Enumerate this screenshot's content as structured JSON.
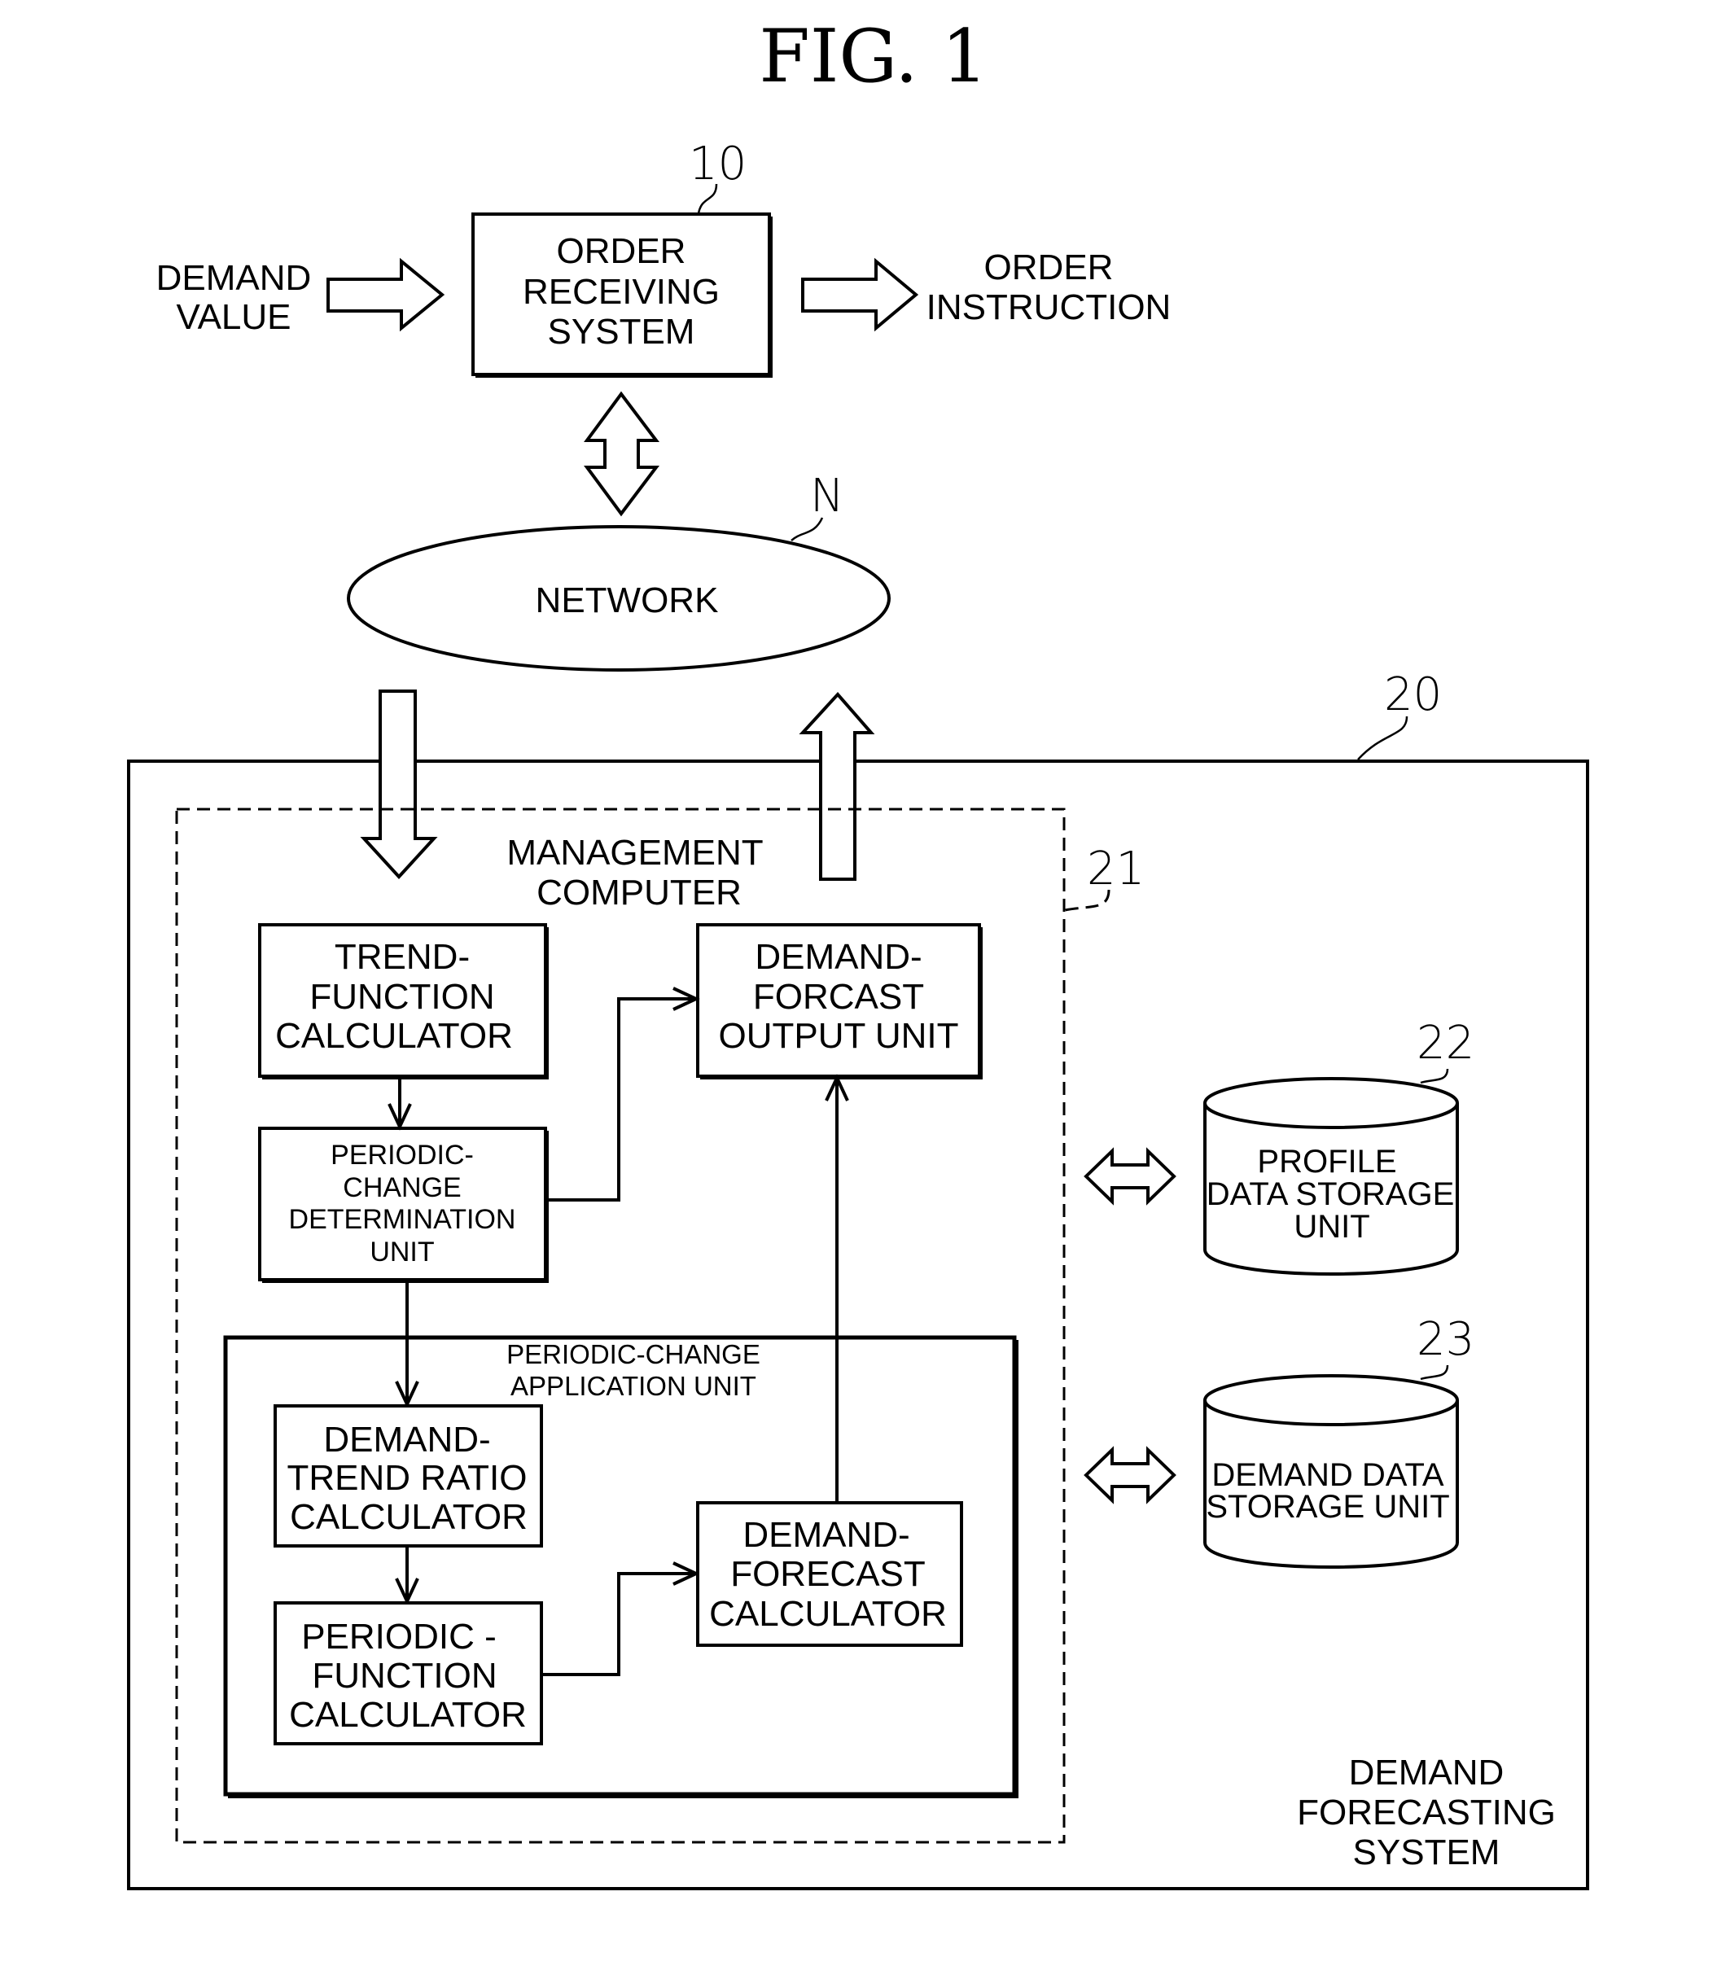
{
  "figure": {
    "title": "FIG. 1",
    "ref_numerals": {
      "order_system": "10",
      "network": "N",
      "forecasting_system": "20",
      "management_computer": "21",
      "profile_storage": "22",
      "demand_storage": "23"
    },
    "inputs": {
      "demand_value": [
        "DEMAND",
        "VALUE"
      ],
      "order_instruction": [
        "ORDER",
        "INSTRUCTION"
      ]
    },
    "order_receiving_system": [
      "ORDER",
      "RECEIVING",
      "SYSTEM"
    ],
    "network": "NETWORK",
    "demand_forecasting_system": [
      "DEMAND",
      "FORECASTING",
      "SYSTEM"
    ],
    "management_computer": [
      "MANAGEMENT",
      "COMPUTER"
    ],
    "trend_function_calculator": [
      "TREND-",
      "FUNCTION",
      "CALCULATOR"
    ],
    "demand_forcast_output_unit": [
      "DEMAND-",
      "FORCAST",
      "OUTPUT UNIT"
    ],
    "periodic_change_determination_unit": [
      "PERIODIC-",
      "CHANGE",
      "DETERMINATION",
      "UNIT"
    ],
    "periodic_change_application_unit": [
      "PERIODIC-CHANGE",
      "APPLICATION UNIT"
    ],
    "demand_trend_ratio_calculator": [
      "DEMAND-",
      "TREND RATIO",
      "CALCULATOR"
    ],
    "periodic_function_calculator": [
      "PERIODIC -",
      "FUNCTION",
      "CALCULATOR"
    ],
    "demand_forecast_calculator": [
      "DEMAND-",
      "FORECAST",
      "CALCULATOR"
    ],
    "profile_data_storage_unit": [
      "PROFILE",
      "DATA STORAGE",
      "UNIT"
    ],
    "demand_data_storage_unit": [
      "DEMAND DATA",
      "STORAGE UNIT"
    ]
  }
}
